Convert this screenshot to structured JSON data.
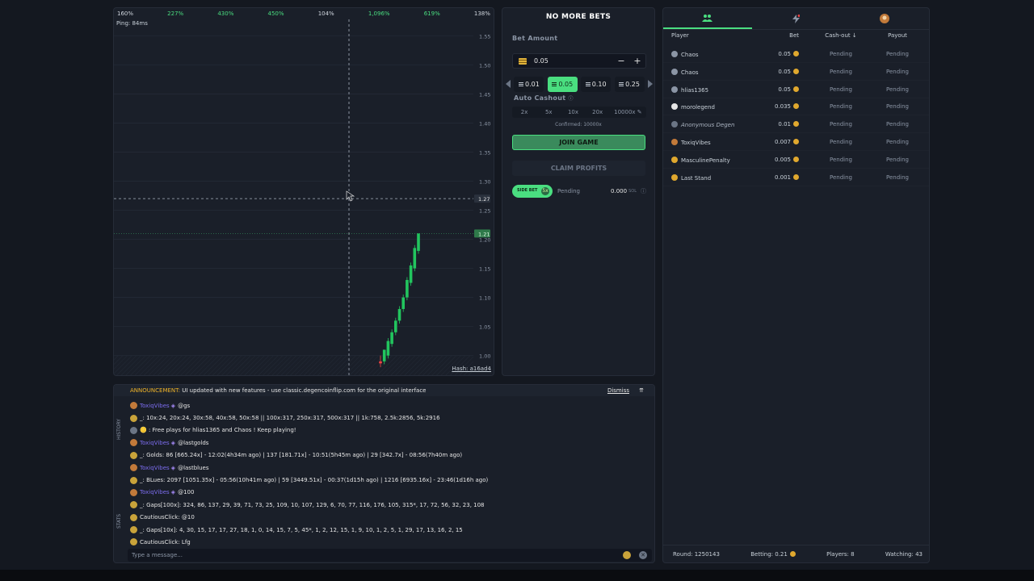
{
  "chart": {
    "top_multipliers": [
      {
        "label": "160%",
        "color": "white"
      },
      {
        "label": "227%",
        "color": "green"
      },
      {
        "label": "430%",
        "color": "green"
      },
      {
        "label": "450%",
        "color": "green"
      },
      {
        "label": "104%",
        "color": "white"
      },
      {
        "label": "1,096%",
        "color": "green"
      },
      {
        "label": "619%",
        "color": "green"
      },
      {
        "label": "138%",
        "color": "white"
      }
    ],
    "ping": "Ping: 84ms",
    "y_ticks": [
      "1.55",
      "1.50",
      "1.45",
      "1.40",
      "1.35",
      "1.30",
      "1.25",
      "1.20",
      "1.15",
      "1.10",
      "1.05",
      "1.00"
    ],
    "crosshair_label": "1.27",
    "current_label": "1.21",
    "hash": "Hash: a16ad4",
    "accent": "#4ade80"
  },
  "chart_data": {
    "type": "candlestick",
    "ylim": [
      0.98,
      1.57
    ],
    "current_value": 1.21,
    "crosshair_value": 1.27,
    "candles": [
      {
        "o": 0.99,
        "c": 0.99,
        "h": 1.0,
        "l": 0.98,
        "color": "red"
      },
      {
        "o": 0.99,
        "c": 1.01,
        "h": 1.01,
        "l": 0.985,
        "color": "green"
      },
      {
        "o": 1.0,
        "c": 1.025,
        "h": 1.03,
        "l": 0.995,
        "color": "green"
      },
      {
        "o": 1.02,
        "c": 1.04,
        "h": 1.045,
        "l": 1.015,
        "color": "green"
      },
      {
        "o": 1.04,
        "c": 1.06,
        "h": 1.065,
        "l": 1.035,
        "color": "green"
      },
      {
        "o": 1.06,
        "c": 1.08,
        "h": 1.085,
        "l": 1.055,
        "color": "green"
      },
      {
        "o": 1.08,
        "c": 1.1,
        "h": 1.105,
        "l": 1.075,
        "color": "green"
      },
      {
        "o": 1.1,
        "c": 1.13,
        "h": 1.135,
        "l": 1.095,
        "color": "green"
      },
      {
        "o": 1.125,
        "c": 1.155,
        "h": 1.16,
        "l": 1.12,
        "color": "green"
      },
      {
        "o": 1.15,
        "c": 1.185,
        "h": 1.19,
        "l": 1.145,
        "color": "green"
      },
      {
        "o": 1.18,
        "c": 1.21,
        "h": 1.21,
        "l": 1.175,
        "color": "green"
      }
    ]
  },
  "bet": {
    "title": "No More Bets",
    "amount_label": "Bet Amount",
    "amount_value": "0.05",
    "minus": "−",
    "plus": "+",
    "presets": [
      {
        "label": "0.01",
        "active": false
      },
      {
        "label": "0.05",
        "active": true
      },
      {
        "label": "0.10",
        "active": false
      },
      {
        "label": "0.25",
        "active": false
      }
    ],
    "auto_label": "Auto Cashout",
    "auto_options": [
      "2x",
      "5x",
      "10x",
      "20x",
      "10000x ✎"
    ],
    "confirmed": "Confirmed: 10000x",
    "join_label": "Join Game",
    "claim_label": "Claim Profits",
    "toggle_text": "SIDE BET",
    "toggle_knob": "5x",
    "status_pending": "Pending",
    "status_amount": "0.000",
    "status_unit": "SOL",
    "status_info": "ⓘ"
  },
  "players": {
    "tab_icons": [
      "users-icon",
      "lightning-icon",
      "avatar-icon"
    ],
    "headers": {
      "player": "Player",
      "bet": "Bet",
      "cashout": "Cash-out ↓",
      "payout": "Payout"
    },
    "rows": [
      {
        "name": "Chaos",
        "bet": "0.05",
        "cashout": "Pending",
        "payout": "Pending",
        "avatar": "#8b95a5",
        "italic": false
      },
      {
        "name": "Chaos",
        "bet": "0.05",
        "cashout": "Pending",
        "payout": "Pending",
        "avatar": "#8b95a5",
        "italic": false
      },
      {
        "name": "hlias1365",
        "bet": "0.05",
        "cashout": "Pending",
        "payout": "Pending",
        "avatar": "#8b95a5",
        "italic": false
      },
      {
        "name": "morolegend",
        "bet": "0.035",
        "cashout": "Pending",
        "payout": "Pending",
        "avatar": "#e6e6e6",
        "italic": false
      },
      {
        "name": "Anonymous Degen",
        "bet": "0.01",
        "cashout": "Pending",
        "payout": "Pending",
        "avatar": "#6b7585",
        "italic": true
      },
      {
        "name": "ToxiqVibes",
        "bet": "0.007",
        "cashout": "Pending",
        "payout": "Pending",
        "avatar": "#c27a3a",
        "italic": false
      },
      {
        "name": "MasculinePenalty",
        "bet": "0.005",
        "cashout": "Pending",
        "payout": "Pending",
        "avatar": "#e0a82e",
        "italic": false
      },
      {
        "name": "Last Stand",
        "bet": "0.001",
        "cashout": "Pending",
        "payout": "Pending",
        "avatar": "#e0a82e",
        "italic": false
      }
    ],
    "footer": {
      "round": "Round: 1250143",
      "betting": "Betting: 0.21",
      "players": "Players: 8",
      "watching": "Watching: 43"
    }
  },
  "chat": {
    "announcement_label": "ANNOUNCEMENT:",
    "announcement_text": "UI updated with new features - use classic.degencoinflip.com for the original interface",
    "dismiss": "Dismiss",
    "pin": "⇈",
    "side_history": "HISTORY",
    "side_stats": "STATS",
    "messages": [
      {
        "avatar": "t",
        "user": "ToxiqVibes",
        "text": "@gs"
      },
      {
        "avatar": "b",
        "user": "",
        "text": "_: 10x:24, 20x:24, 30x:58, 40x:58, 50x:58 || 100x:317, 250x:317, 500x:317 || 1k:758, 2.5k:2856, 5k:2916"
      },
      {
        "avatar": "g",
        "user": "",
        "text": "🪙 : Free plays for hlias1365 and Chaos ! Keep playing!"
      },
      {
        "avatar": "t",
        "user": "ToxiqVibes",
        "text": "@lastgolds"
      },
      {
        "avatar": "b",
        "user": "",
        "text": "_: Golds: 86 [665.24x] - 12:02(4h34m ago) | 137 [181.71x] - 10:51(5h45m ago) | 29 [342.7x] - 08:56(7h40m ago)"
      },
      {
        "avatar": "t",
        "user": "ToxiqVibes",
        "text": "@lastblues"
      },
      {
        "avatar": "b",
        "user": "",
        "text": "_: BLues: 2097 [1051.35x] - 05:56(10h41m ago) | 59 [3449.51x] - 00:37(1d15h ago) | 1216 [6935.16x] - 23:46(1d16h ago)"
      },
      {
        "avatar": "t",
        "user": "ToxiqVibes",
        "text": "@100"
      },
      {
        "avatar": "b",
        "user": "",
        "text": "_: Gaps[100x]: 324, 86, 137, 29, 39, 71, 73, 25, 109, 10, 107, 129, 6, 70, 77, 116, 176, 105, 315*, 17, 72, 56, 32, 23, 108"
      },
      {
        "avatar": "b",
        "user": "",
        "text": "CautiousClick: @10"
      },
      {
        "avatar": "b",
        "user": "",
        "text": "_: Gaps[10x]: 4, 30, 15, 17, 17, 27, 18, 1, 0, 14, 15, 7, 5, 45*, 1, 2, 12, 15, 1, 9, 10, 1, 2, 5, 1, 29, 17, 13, 16, 2, 15"
      },
      {
        "avatar": "b",
        "user": "",
        "text": "CautiousClick: Lfg"
      }
    ],
    "input_placeholder": "Type a message..."
  }
}
